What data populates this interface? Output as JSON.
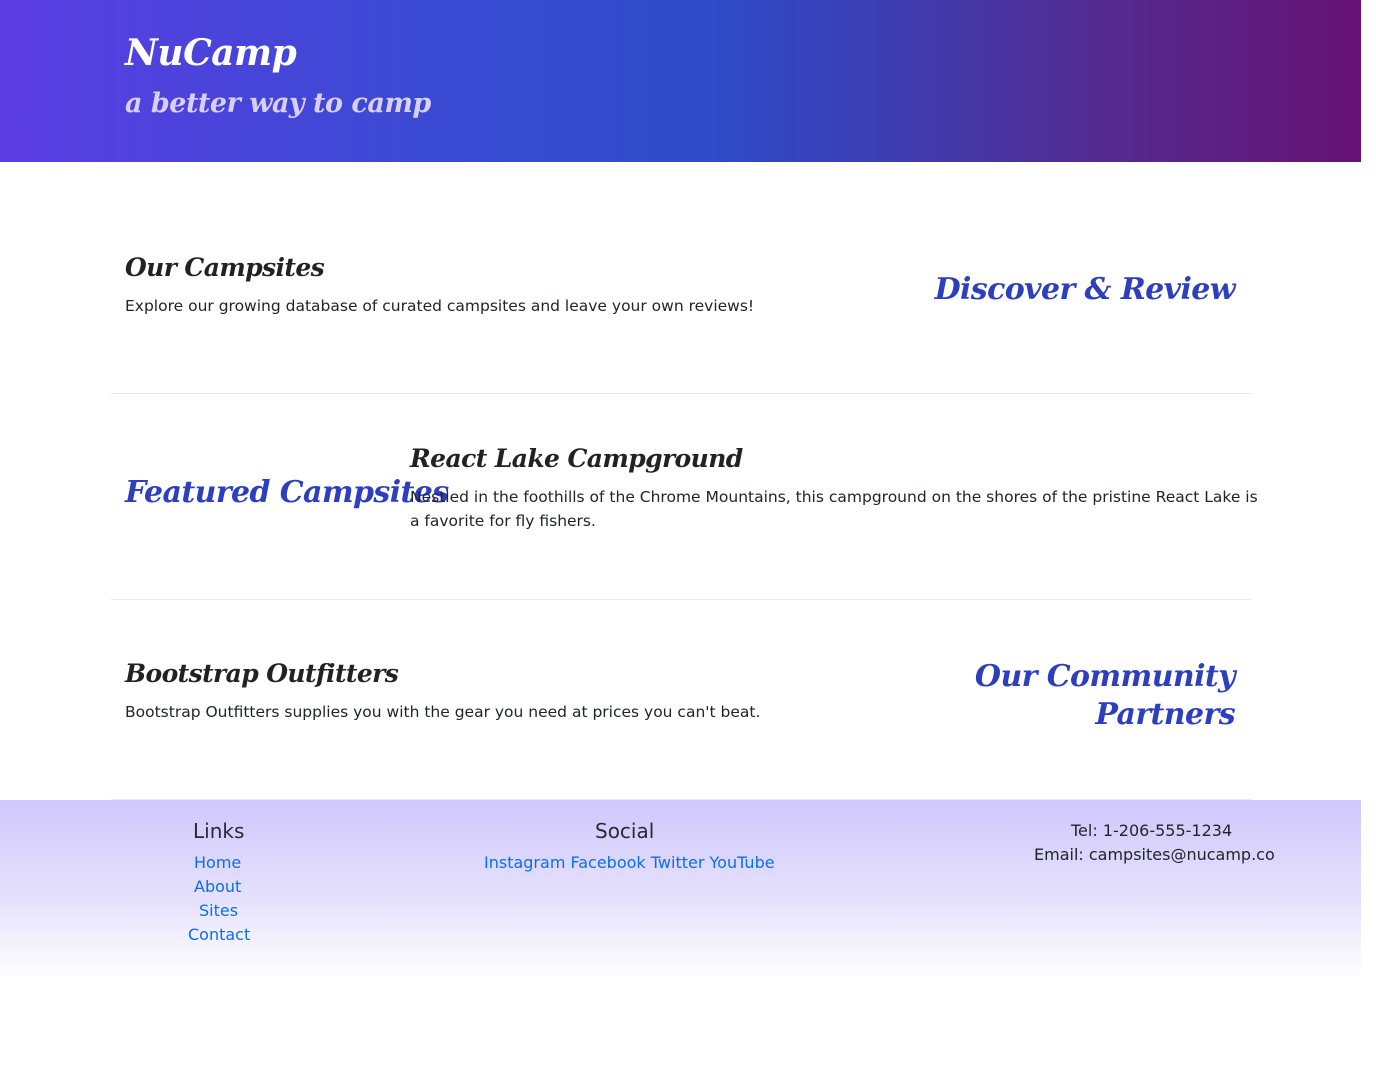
{
  "header": {
    "brand": "NuCamp",
    "tagline": "a better way to camp"
  },
  "sections": {
    "campsites": {
      "title": "Our Campsites",
      "text": "Explore our growing database of curated campsites and leave your own reviews!",
      "side_heading": "Discover & Review"
    },
    "featured": {
      "side_heading": "Featured Campsites",
      "title": "React Lake Campground",
      "text_line1": "Nestled in the foothills of the Chrome Mountains, this campground on the shores of the pristine React Lake is",
      "text_line2": "a favorite for fly fishers."
    },
    "partners": {
      "title": "Bootstrap Outfitters",
      "text": "Bootstrap Outfitters supplies you with the gear you need at prices you can't beat.",
      "side_heading_line1": "Our Community",
      "side_heading_line2": "Partners"
    }
  },
  "footer": {
    "links_heading": "Links",
    "links": [
      "Home",
      "About",
      "Sites",
      "Contact"
    ],
    "social_heading": "Social",
    "social": [
      "Instagram",
      "Facebook",
      "Twitter",
      "YouTube"
    ],
    "tel": "Tel: 1-206-555-1234",
    "email": "Email: campsites@nucamp.co"
  },
  "colors": {
    "accent_blue": "#2e3fbe",
    "link_blue": "#0b6fe6",
    "header_gradient_start": "#5b3de2",
    "header_gradient_end": "#651273",
    "footer_top": "#cfc7fb"
  }
}
